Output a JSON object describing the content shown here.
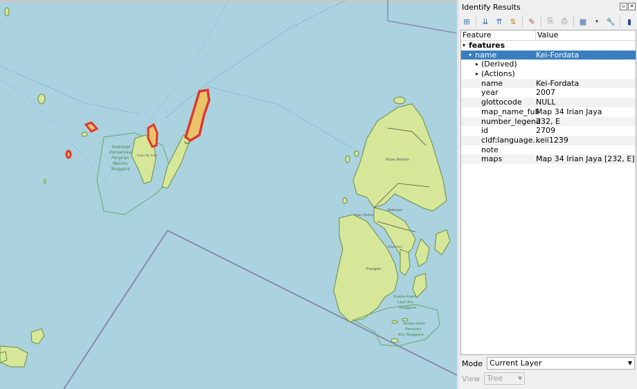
{
  "map": {
    "colors": {
      "sea": "#aad3df",
      "land": "#d6e79a",
      "coast": "#6b8a43",
      "highlight": "#e0382e",
      "highlight_fill": "#e8c36a",
      "boundary": "#8a8aa8",
      "park": "#66a86a"
    },
    "labels": {
      "kawasan": [
        "Kawasan",
        "Konservasi",
        "Perairan",
        "Maluku",
        "Tenggara"
      ],
      "kei_small": "Pulau Kei Kecil",
      "tual": "Tual",
      "pulau_wokam": "Pulau Wokam",
      "kobroor": "Kobroor",
      "pulau_kola": "Pulau Kola",
      "pulau_maikoor": "Pulau Maikoor",
      "trangan": "Trangan",
      "aru_upper": [
        "Suaka Alam",
        "Laut Aru",
        "Tenggara"
      ],
      "aru_lower": [
        "Suaka Alam",
        "Perairan",
        "Aru Tenggara"
      ]
    }
  },
  "panel": {
    "title": "Identify Results",
    "toolbar_icons": [
      "expand-icon",
      "collapse-icon",
      "expand-new-icon",
      "collapse-all-icon",
      "clear-highlight-icon",
      "copy-icon",
      "print-icon",
      "form-icon",
      "settings-icon",
      "help-icon"
    ],
    "columns": {
      "feature": "Feature",
      "value": "Value"
    },
    "features_label": "features",
    "selected": {
      "key": "name",
      "value": "Kei-Fordata"
    },
    "derived": "(Derived)",
    "actions": "(Actions)",
    "attributes": [
      {
        "key": "name",
        "value": "Kei-Fordata"
      },
      {
        "key": "year",
        "value": "2007"
      },
      {
        "key": "glottocode",
        "value": "NULL"
      },
      {
        "key": "map_name_full",
        "value": "Map 34 Irian Jaya"
      },
      {
        "key": "number_legend",
        "value": "232, E"
      },
      {
        "key": "id",
        "value": "2709"
      },
      {
        "key": "cldf:language...",
        "value": "keii1239"
      },
      {
        "key": "note",
        "value": ""
      },
      {
        "key": "maps",
        "value": "Map 34 Irian Jaya [232, E]"
      }
    ],
    "mode_label": "Mode",
    "mode_value": "Current Layer",
    "view_label": "View",
    "view_value": "Tree"
  }
}
